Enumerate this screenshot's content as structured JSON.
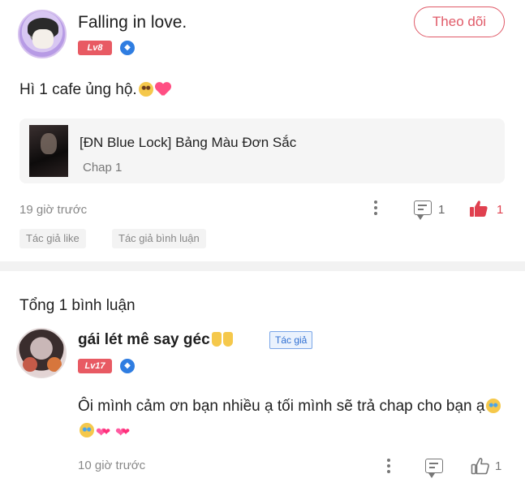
{
  "post": {
    "author_name": "Falling in love.",
    "level": "Lv8",
    "follow_label": "Theo dõi",
    "content": "Hì 1 cafe ủng hộ.",
    "story": {
      "title": "[ĐN Blue Lock] Bảng Màu Đơn Sắc",
      "chapter": "Chap 1"
    },
    "time": "19 giờ trước",
    "comment_count": "1",
    "like_count": "1",
    "liked": true,
    "tags": [
      "Tác giả like",
      "Tác giả bình luận"
    ]
  },
  "comments_section": {
    "total_label": "Tổng 1 bình luận"
  },
  "reply": {
    "author_name": "gái lét mê say géc",
    "author_badge": "Tác giả",
    "level": "Lv17",
    "content": "Ôi mình cảm ơn bạn nhiều ạ tối mình sẽ trả chap cho bạn ạ",
    "time": "10 giờ trước",
    "like_count": "1",
    "liked": false
  },
  "colors": {
    "accent": "#e05a68",
    "level_badge": "#e85a63",
    "shield": "#2f7de1",
    "author_badge_bg": "#eaf2fd",
    "author_badge_text": "#2f6fd2"
  }
}
